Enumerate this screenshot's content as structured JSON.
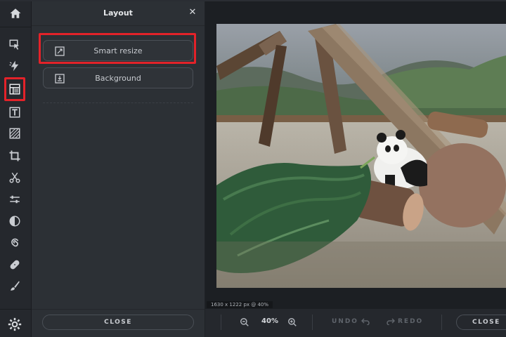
{
  "panel": {
    "title": "Layout",
    "buttons": [
      {
        "label": "Smart resize",
        "icon": "smart-resize-icon",
        "highlighted": true
      },
      {
        "label": "Background",
        "icon": "background-icon",
        "highlighted": false
      }
    ],
    "close_label": "CLOSE"
  },
  "sidebar": {
    "tools": [
      {
        "name": "select-tool",
        "icon": "cursor-icon"
      },
      {
        "name": "adjust-tool",
        "icon": "lightning-icon"
      },
      {
        "name": "layout-tool",
        "icon": "layout-icon",
        "active": true
      },
      {
        "name": "text-tool",
        "icon": "text-icon"
      },
      {
        "name": "texture-tool",
        "icon": "texture-icon"
      },
      {
        "name": "crop-tool",
        "icon": "crop-icon"
      },
      {
        "name": "cut-tool",
        "icon": "scissors-icon"
      },
      {
        "name": "filters-tool",
        "icon": "sliders-icon"
      },
      {
        "name": "contrast-tool",
        "icon": "contrast-icon"
      },
      {
        "name": "swirl-tool",
        "icon": "swirl-icon"
      },
      {
        "name": "heal-tool",
        "icon": "bandage-icon"
      },
      {
        "name": "brush-tool",
        "icon": "brush-icon"
      }
    ]
  },
  "canvas": {
    "image_info": "1630 x 1222 px @ 40%"
  },
  "bottombar": {
    "zoom": "40%",
    "undo_label": "UNDO",
    "redo_label": "REDO",
    "close_label": "CLOSE"
  },
  "colors": {
    "accent_highlight": "#e32229",
    "panel_bg": "#2c3035",
    "sidebar_bg": "#25282d"
  }
}
